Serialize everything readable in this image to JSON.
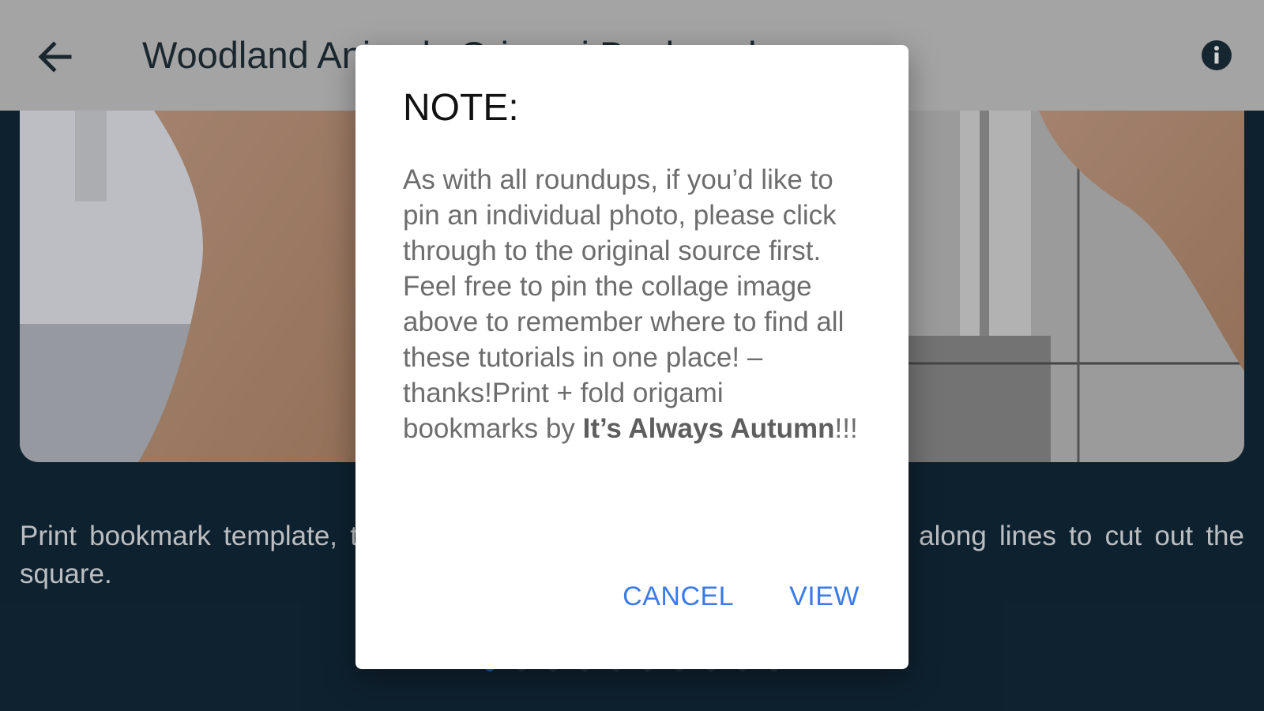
{
  "appbar": {
    "back_icon": "arrow-left-icon",
    "title": "Woodland Animals Origami Bookmarks",
    "info_icon": "info-icon"
  },
  "photo": {
    "caption": "Print bookmark template, then fold the paper along the lines and cut along lines to cut out the square."
  },
  "pager": {
    "count": 10,
    "active_index": 0
  },
  "dialog": {
    "title": "NOTE:",
    "body_text": "As with all roundups, if you’d like to pin an individual photo, please click through to the original source first. Feel free to pin the collage image above to remember where to find all these tutorials in one place! – thanks!Print + fold origami bookmarks by ",
    "body_bold": "It’s Always Autumn",
    "body_suffix": "!!!",
    "cancel_label": "CANCEL",
    "view_label": "VIEW"
  },
  "colors": {
    "appbar_bg": "#c8c8c8",
    "page_bg": "#12293a",
    "accent": "#3a7be8",
    "pager_active": "#2a6ad8"
  }
}
